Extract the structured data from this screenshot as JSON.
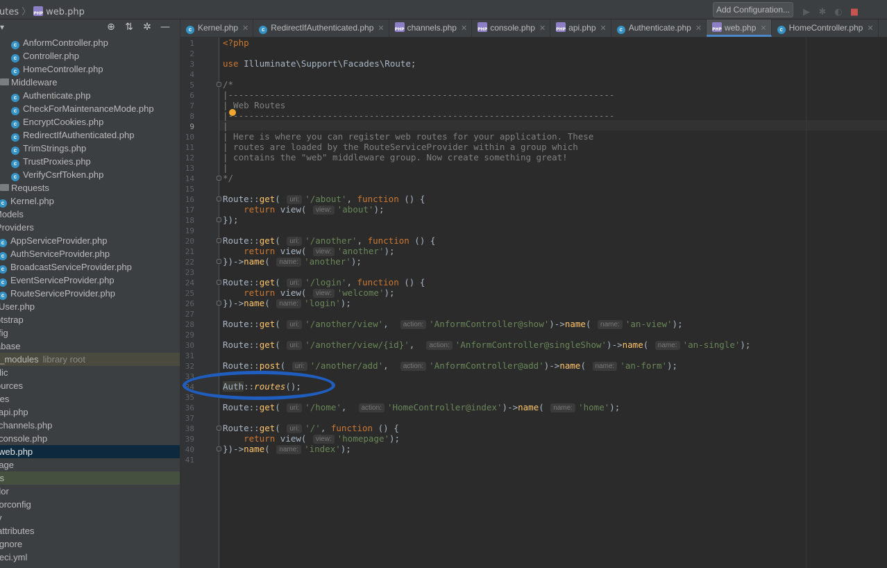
{
  "breadcrumb": {
    "folder": "routes",
    "file": "web.php"
  },
  "toolbar": {
    "add_configuration": "Add Configuration..."
  },
  "sidebar": {
    "rows": [
      {
        "label": "AnformController.php",
        "kind": "class",
        "indent": 16
      },
      {
        "label": "Controller.php",
        "kind": "class",
        "indent": 16
      },
      {
        "label": "HomeController.php",
        "kind": "class",
        "indent": 16
      },
      {
        "label": "Middleware",
        "kind": "folder",
        "indent": 0
      },
      {
        "label": "Authenticate.php",
        "kind": "class",
        "indent": 16
      },
      {
        "label": "CheckForMaintenanceMode.php",
        "kind": "class",
        "indent": 16
      },
      {
        "label": "EncryptCookies.php",
        "kind": "class",
        "indent": 16
      },
      {
        "label": "RedirectIfAuthenticated.php",
        "kind": "class",
        "indent": 16
      },
      {
        "label": "TrimStrings.php",
        "kind": "class",
        "indent": 16
      },
      {
        "label": "TrustProxies.php",
        "kind": "class",
        "indent": 16
      },
      {
        "label": "VerifyCsrfToken.php",
        "kind": "class",
        "indent": 16
      },
      {
        "label": "Requests",
        "kind": "folder",
        "indent": 0
      },
      {
        "label": "Kernel.php",
        "kind": "class",
        "indent": -2
      },
      {
        "label": "Models",
        "kind": "text",
        "indent": -8
      },
      {
        "label": "Providers",
        "kind": "text",
        "indent": -6
      },
      {
        "label": "AppServiceProvider.php",
        "kind": "class",
        "indent": -2
      },
      {
        "label": "AuthServiceProvider.php",
        "kind": "class",
        "indent": -2
      },
      {
        "label": "BroadcastServiceProvider.php",
        "kind": "class",
        "indent": -2
      },
      {
        "label": "EventServiceProvider.php",
        "kind": "class",
        "indent": -2
      },
      {
        "label": "RouteServiceProvider.php",
        "kind": "class",
        "indent": -2
      },
      {
        "label": "User.php",
        "kind": "text",
        "indent": -2
      },
      {
        "label": "otstrap",
        "kind": "text",
        "indent": -6
      },
      {
        "label": "fig",
        "kind": "text",
        "indent": -2
      },
      {
        "label": "abase",
        "kind": "text",
        "indent": -6
      },
      {
        "label": "e_modules",
        "kind": "lib",
        "indent": -8,
        "suffix": "library root"
      },
      {
        "label": "blic",
        "kind": "text",
        "indent": -8
      },
      {
        "label": "ources",
        "kind": "text",
        "indent": -6
      },
      {
        "label": "tes",
        "kind": "text",
        "indent": -4
      },
      {
        "label": "api.php",
        "kind": "text",
        "indent": -2
      },
      {
        "label": "channels.php",
        "kind": "text",
        "indent": -2
      },
      {
        "label": "console.php",
        "kind": "text",
        "indent": -2
      },
      {
        "label": "web.php",
        "kind": "selected",
        "indent": -2
      },
      {
        "label": "rage",
        "kind": "text",
        "indent": -6
      },
      {
        "label": "ts",
        "kind": "mod",
        "indent": -4
      },
      {
        "label": "dor",
        "kind": "text",
        "indent": -6
      },
      {
        "label": "itorconfig",
        "kind": "text",
        "indent": -8
      },
      {
        "label": "v",
        "kind": "text",
        "indent": -4
      },
      {
        "label": "attributes",
        "kind": "text",
        "indent": -4
      },
      {
        "label": "ignore",
        "kind": "text",
        "indent": -4
      },
      {
        "label": "leci.yml",
        "kind": "text",
        "indent": -4
      }
    ]
  },
  "tabs": [
    {
      "label": "Kernel.php",
      "icon": "class"
    },
    {
      "label": "RedirectIfAuthenticated.php",
      "icon": "class"
    },
    {
      "label": "channels.php",
      "icon": "php"
    },
    {
      "label": "console.php",
      "icon": "php"
    },
    {
      "label": "api.php",
      "icon": "php"
    },
    {
      "label": "Authenticate.php",
      "icon": "class"
    },
    {
      "label": "web.php",
      "icon": "php",
      "active": true
    },
    {
      "label": "HomeController.php",
      "icon": "class"
    }
  ],
  "editor": {
    "line_count": 41,
    "current_line": 9
  },
  "colors": {
    "keyword": "#cc7832",
    "string": "#6a8759",
    "comment": "#808080",
    "function": "#ffc66d",
    "annotation_circle": "#1f5dbe"
  }
}
